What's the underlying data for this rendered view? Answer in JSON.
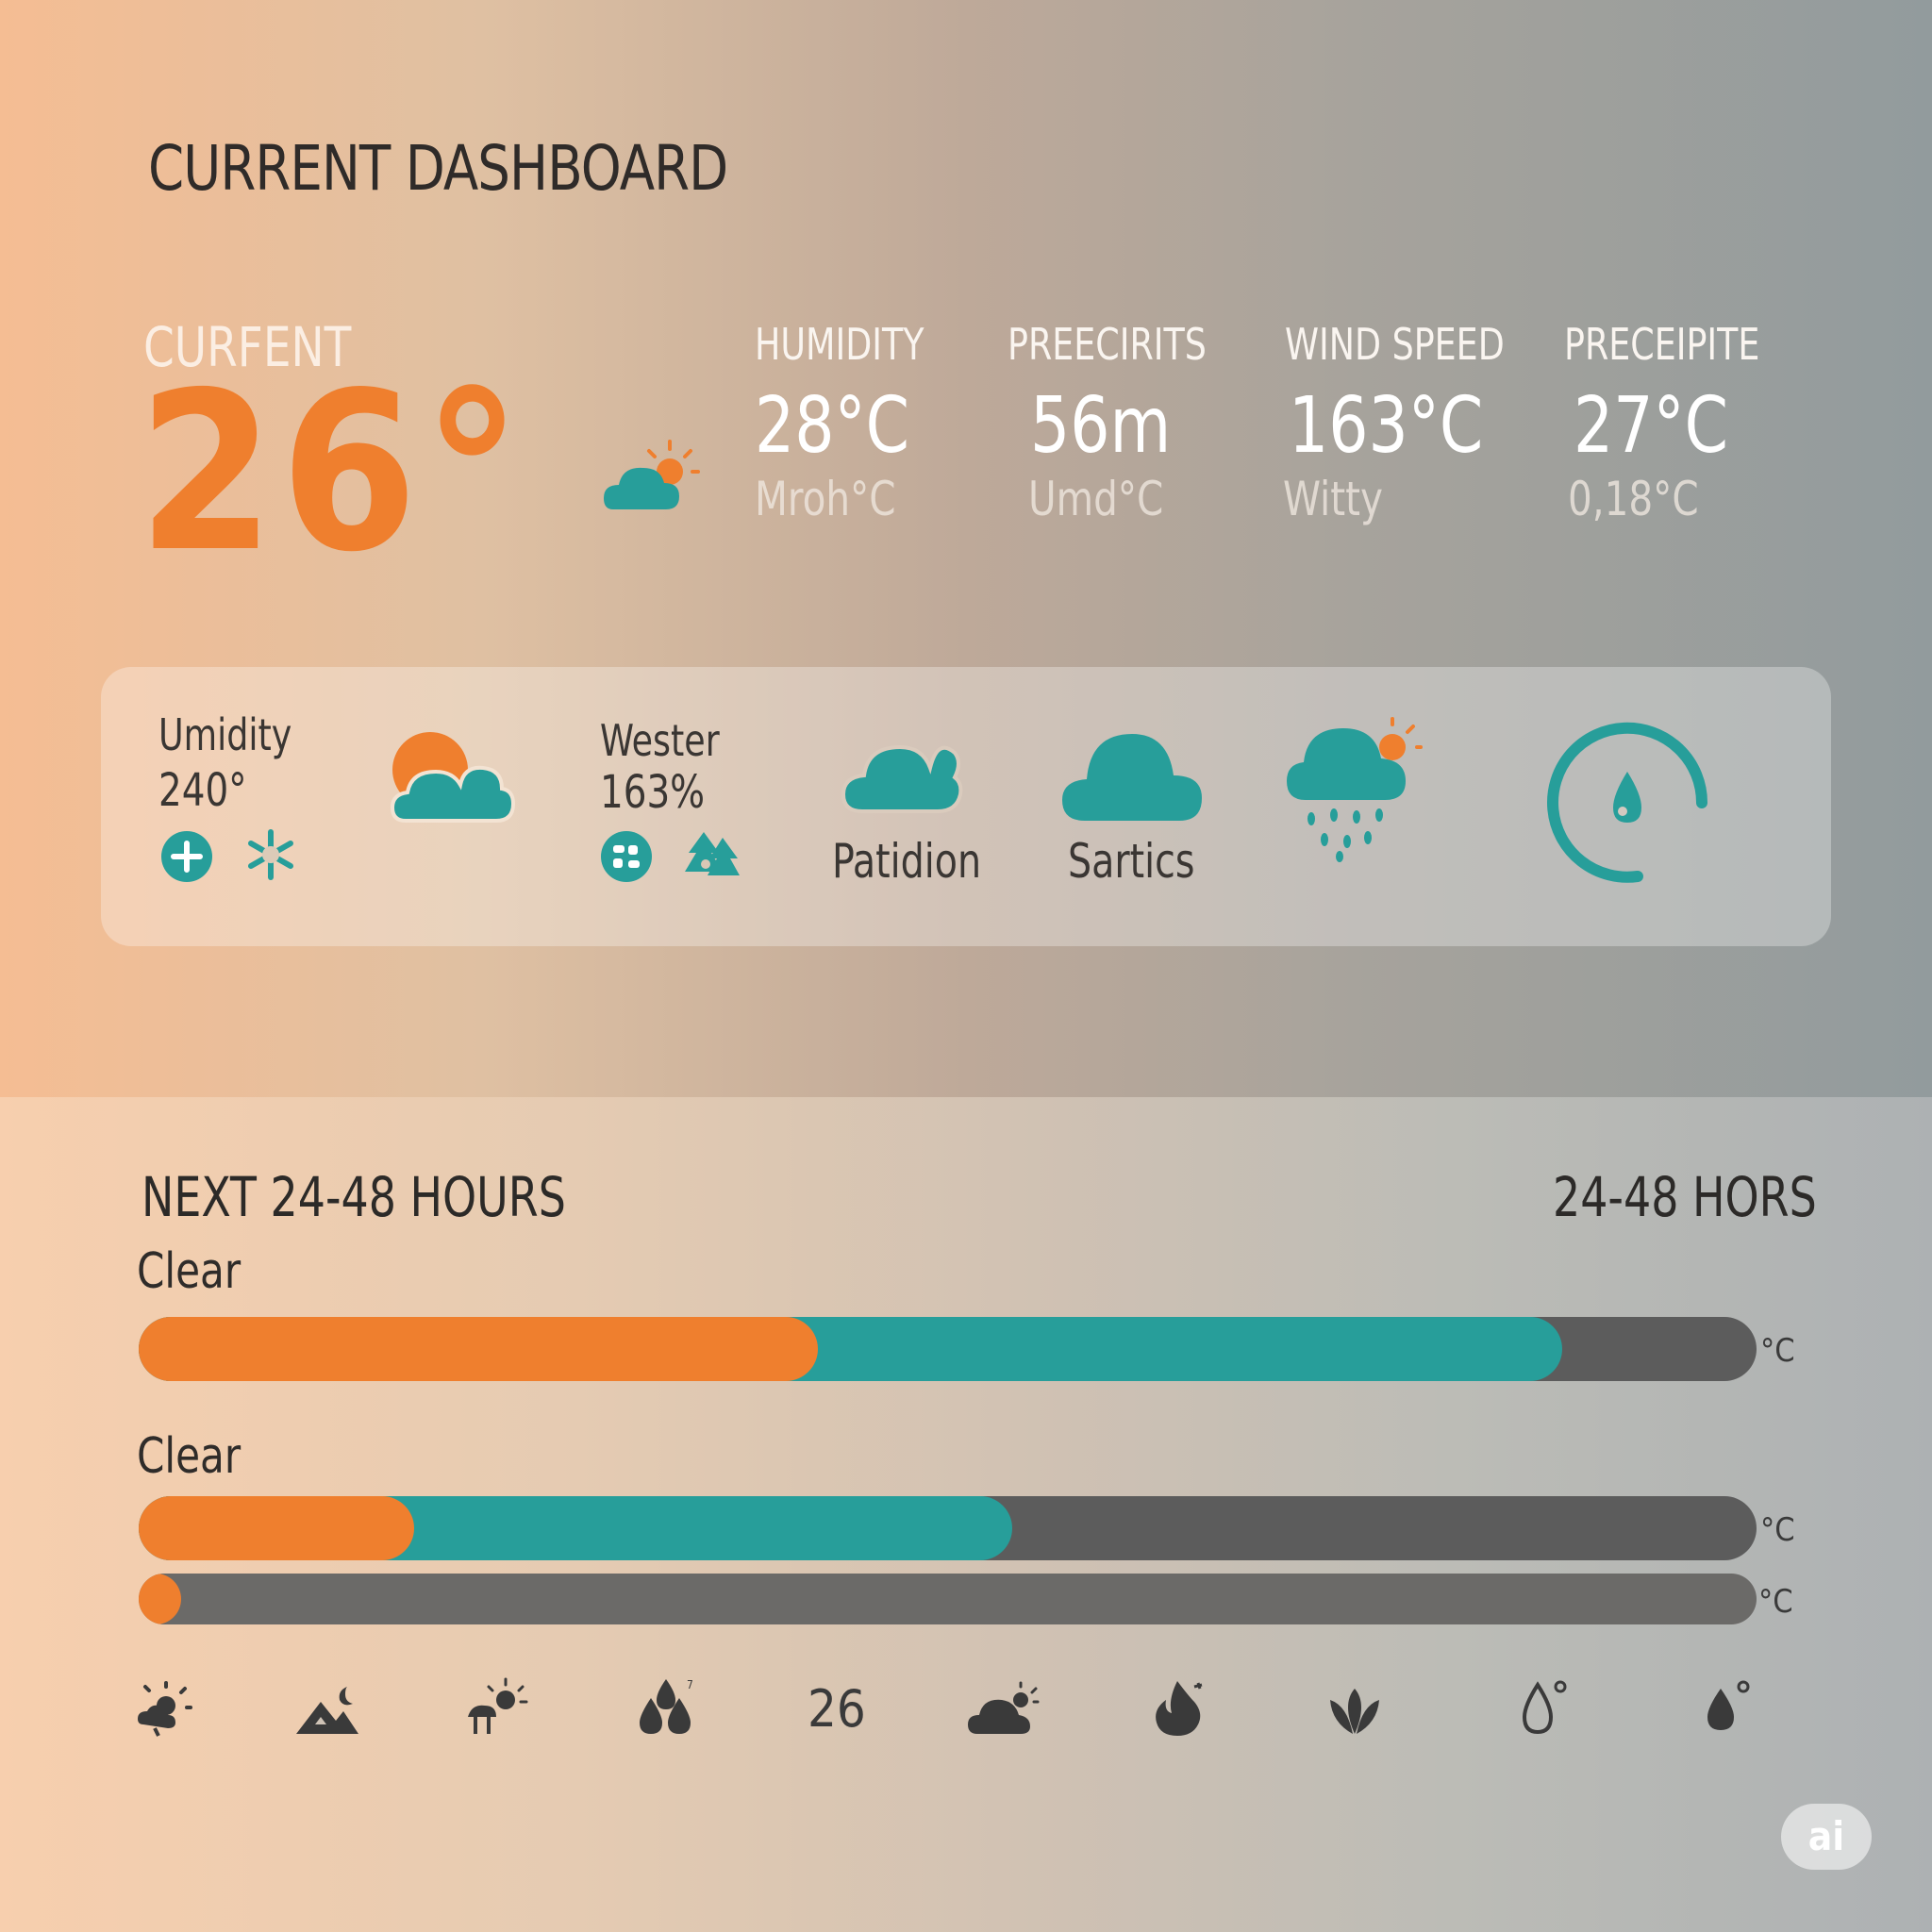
{
  "header": {
    "title": "CURRENT DASHBOARD"
  },
  "current": {
    "label": "CURFENT",
    "temperature": "26°"
  },
  "metrics": [
    {
      "label": "HUMIDITY",
      "value": "28°C",
      "sub": "Mroh°C"
    },
    {
      "label": "PREECIRITS",
      "value": "56m",
      "sub": "Umd°C"
    },
    {
      "label": "WIND SPEED",
      "value": "163°C",
      "sub": "Witty"
    },
    {
      "label": "PRECEIPITE",
      "value": "27°C",
      "sub": "0,18°C"
    }
  ],
  "panel": {
    "item1": {
      "label": "Umidity",
      "value": "240°"
    },
    "item2": {
      "label": "Wester",
      "value": "163%"
    },
    "item3": {
      "label": "Patidion"
    },
    "item4": {
      "label": "Sartics"
    },
    "gauge": {
      "icon": "water-drop-icon"
    }
  },
  "forecast": {
    "title": "NEXT 24-48 HOURS",
    "range_label": "24-48 HORS",
    "rows": [
      {
        "label": "Clear",
        "unit": "°C",
        "orange_fraction": 0.42,
        "teal_fraction": 0.88
      },
      {
        "label": "Clear",
        "unit": "°C",
        "orange_fraction": 0.17,
        "teal_fraction": 0.54
      },
      {
        "label": "",
        "unit": "°C",
        "orange_fraction": 0.026,
        "teal_fraction": 0
      }
    ],
    "icons": [
      "sun-cloud-icon",
      "mountain-moon-icon",
      "sun-tree-icon",
      "cloud-droplets-icon",
      "cloud-sun-icon",
      "flame-icon",
      "leaf-icon",
      "drop-outline-icon",
      "drop-filled-icon"
    ],
    "inline_value": "26"
  },
  "colors": {
    "accent": "#ef7f2e",
    "teal": "#279e9a",
    "track": "#5c5c5c"
  },
  "watermark": "ai"
}
